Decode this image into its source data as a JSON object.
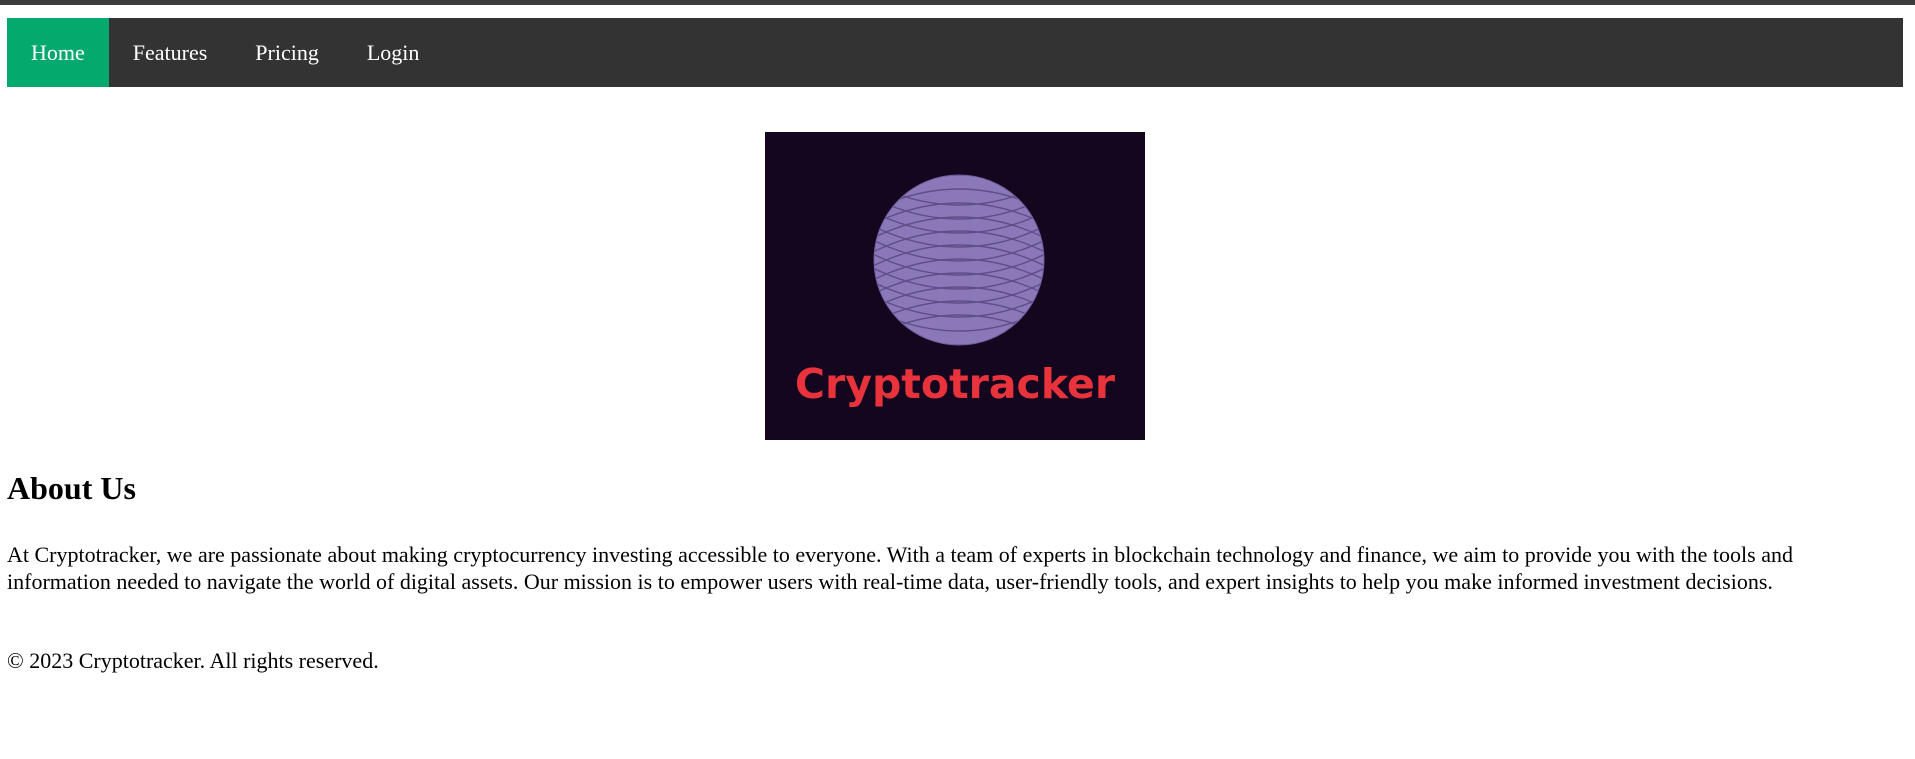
{
  "nav": {
    "items": [
      {
        "label": "Home",
        "active": true
      },
      {
        "label": "Features",
        "active": false
      },
      {
        "label": "Pricing",
        "active": false
      },
      {
        "label": "Login",
        "active": false
      }
    ]
  },
  "logo": {
    "text": "Cryptotracker",
    "colors": {
      "background": "#15061f",
      "globe": "#8a78b8",
      "text": "#e8333c"
    }
  },
  "about": {
    "heading": "About Us",
    "body": "At Cryptotracker, we are passionate about making cryptocurrency investing accessible to everyone. With a team of experts in blockchain technology and finance, we aim to provide you with the tools and information needed to navigate the world of digital assets. Our mission is to empower users with real-time data, user-friendly tools, and expert insights to help you make informed investment decisions."
  },
  "footer": {
    "text": "© 2023 Cryptotracker. All rights reserved."
  },
  "colors": {
    "navbar": "#333333",
    "active": "#04aa6d"
  }
}
